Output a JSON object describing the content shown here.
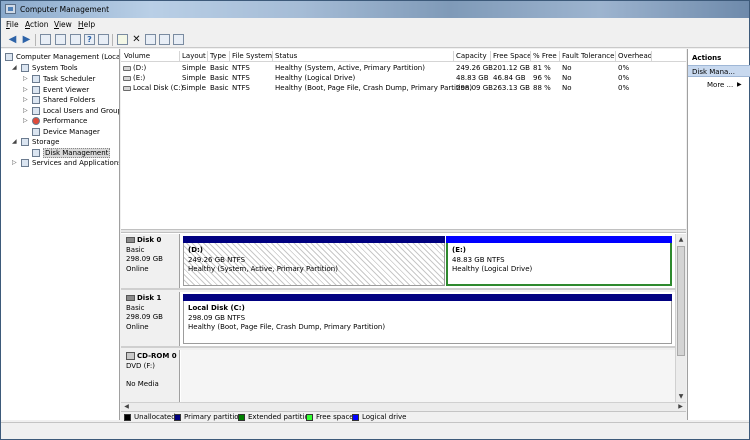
{
  "window": {
    "title": "Computer Management"
  },
  "menu": [
    {
      "label": "File",
      "u": "F",
      "rest": "ile"
    },
    {
      "label": "Action",
      "u": "A",
      "rest": "ction"
    },
    {
      "label": "View",
      "u": "V",
      "rest": "iew"
    },
    {
      "label": "Help",
      "u": "H",
      "rest": "elp"
    }
  ],
  "toolbar": [
    "back-icon",
    "forward-icon",
    "up-folder-icon",
    "console-tree-icon",
    "properties-icon",
    "help-icon",
    "pane-icon",
    "export-icon",
    "delete-icon",
    "open-icon",
    "search-icon",
    "details-icon"
  ],
  "tree": {
    "root": "Computer Management (Local",
    "items": [
      {
        "label": "System Tools",
        "level": 1,
        "expander": "◢"
      },
      {
        "label": "Task Scheduler",
        "level": 2,
        "expander": "▷"
      },
      {
        "label": "Event Viewer",
        "level": 2,
        "expander": "▷"
      },
      {
        "label": "Shared Folders",
        "level": 2,
        "expander": "▷"
      },
      {
        "label": "Local Users and Groups",
        "level": 2,
        "expander": "▷"
      },
      {
        "label": "Performance",
        "level": 2,
        "expander": "▷"
      },
      {
        "label": "Device Manager",
        "level": 2,
        "expander": ""
      },
      {
        "label": "Storage",
        "level": 1,
        "expander": "◢"
      },
      {
        "label": "Disk Management",
        "level": 2,
        "expander": ""
      },
      {
        "label": "Services and Applications",
        "level": 1,
        "expander": "▷"
      }
    ]
  },
  "volume_table": {
    "headers": [
      "Volume",
      "Layout",
      "Type",
      "File System",
      "Status",
      "Capacity",
      "Free Space",
      "% Free",
      "Fault Tolerance",
      "Overhead"
    ],
    "rows": [
      [
        "(D:)",
        "Simple",
        "Basic",
        "NTFS",
        "Healthy (System, Active, Primary Partition)",
        "249.26 GB",
        "201.12 GB",
        "81 %",
        "No",
        "0%"
      ],
      [
        "(E:)",
        "Simple",
        "Basic",
        "NTFS",
        "Healthy (Logical Drive)",
        "48.83 GB",
        "46.84 GB",
        "96 %",
        "No",
        "0%"
      ],
      [
        "Local Disk (C:)",
        "Simple",
        "Basic",
        "NTFS",
        "Healthy (Boot, Page File, Crash Dump, Primary Partition)",
        "298.09 GB",
        "263.13 GB",
        "88 %",
        "No",
        "0%"
      ]
    ]
  },
  "disks": [
    {
      "name": "Disk 0",
      "type": "Basic",
      "size": "298.09 GB",
      "state": "Online",
      "partitions": [
        {
          "name": "(D:)",
          "detail": "249.26 GB NTFS",
          "status": "Healthy (System, Active, Primary Partition)"
        },
        {
          "name": "(E:)",
          "detail": "48.83 GB NTFS",
          "status": "Healthy (Logical Drive)"
        }
      ]
    },
    {
      "name": "Disk 1",
      "type": "Basic",
      "size": "298.09 GB",
      "state": "Online",
      "partitions": [
        {
          "name": "Local Disk  (C:)",
          "detail": "298.09 GB NTFS",
          "status": "Healthy (Boot, Page File, Crash Dump, Primary Partition)"
        }
      ]
    },
    {
      "name": "CD-ROM 0",
      "type": "DVD (F:)",
      "state": "No Media"
    }
  ],
  "legend": [
    {
      "label": "Unallocated",
      "color": "#000000"
    },
    {
      "label": "Primary partition",
      "color": "#000080"
    },
    {
      "label": "Extended partition",
      "color": "#008000"
    },
    {
      "label": "Free space",
      "color": "#33ff33"
    },
    {
      "label": "Logical drive",
      "color": "#0000ff"
    }
  ],
  "actions": {
    "title": "Actions",
    "section": "Disk Mana...",
    "more": "More ..."
  },
  "colors": {
    "primary": "#000080",
    "logical": "#0000ff",
    "extended": "#008000",
    "selection": "#2f8a2f"
  }
}
